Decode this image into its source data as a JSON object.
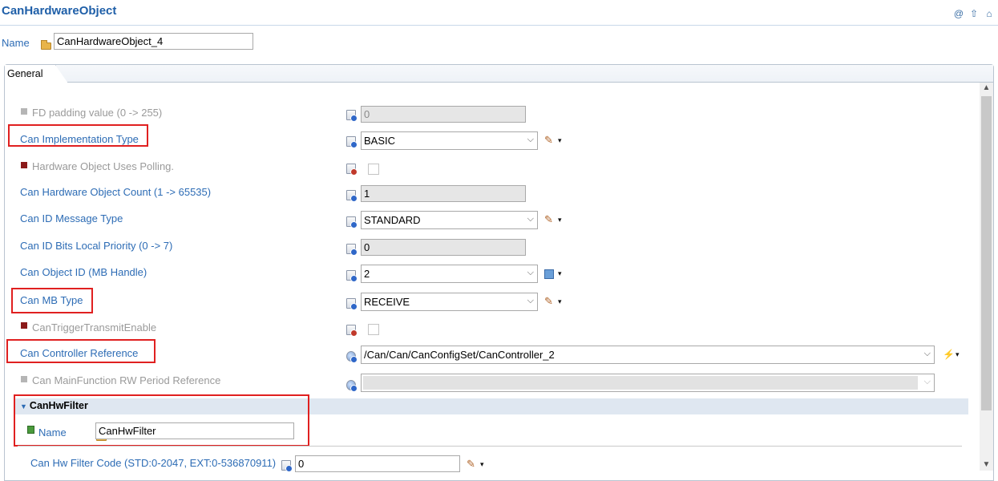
{
  "header": {
    "title": "CanHardwareObject",
    "icons": [
      "at-icon",
      "up-arrow-icon",
      "home-icon"
    ]
  },
  "name_row": {
    "label": "Name",
    "value": "CanHardwareObject_4"
  },
  "tab": {
    "label": "General"
  },
  "fields": {
    "fd_padding": {
      "label": "FD padding value (0 -> 255)",
      "value": "0"
    },
    "impl_type": {
      "label": "Can Implementation Type",
      "value": "BASIC"
    },
    "polling": {
      "label": "Hardware Object Uses Polling."
    },
    "hw_count": {
      "label": "Can Hardware Object Count (1 -> 65535)",
      "value": "1"
    },
    "id_msg_type": {
      "label": "Can ID Message Type",
      "value": "STANDARD"
    },
    "local_priority": {
      "label": "Can ID Bits Local Priority (0 -> 7)",
      "value": "0"
    },
    "object_id": {
      "label": "Can Object ID (MB Handle)",
      "value": "2"
    },
    "mb_type": {
      "label": "Can MB Type",
      "value": "RECEIVE"
    },
    "trigger_tx": {
      "label": "CanTriggerTransmitEnable"
    },
    "controller_ref": {
      "label": "Can Controller Reference",
      "value": "/Can/Can/CanConfigSet/CanController_2"
    },
    "mainfunction_ref": {
      "label": "Can MainFunction RW Period Reference",
      "value": ""
    }
  },
  "hw_filter": {
    "title": "CanHwFilter",
    "name_label": "Name",
    "name_value": "CanHwFilter",
    "code_label": "Can Hw Filter Code (STD:0-2047, EXT:0-536870911)",
    "code_value": "0"
  },
  "glyphs": {
    "dropdown_arrow": "▾",
    "chevron": "⌵",
    "pencil": "✎",
    "scroll_up": "▲",
    "scroll_down": "▼",
    "section_triangle": "▼"
  }
}
